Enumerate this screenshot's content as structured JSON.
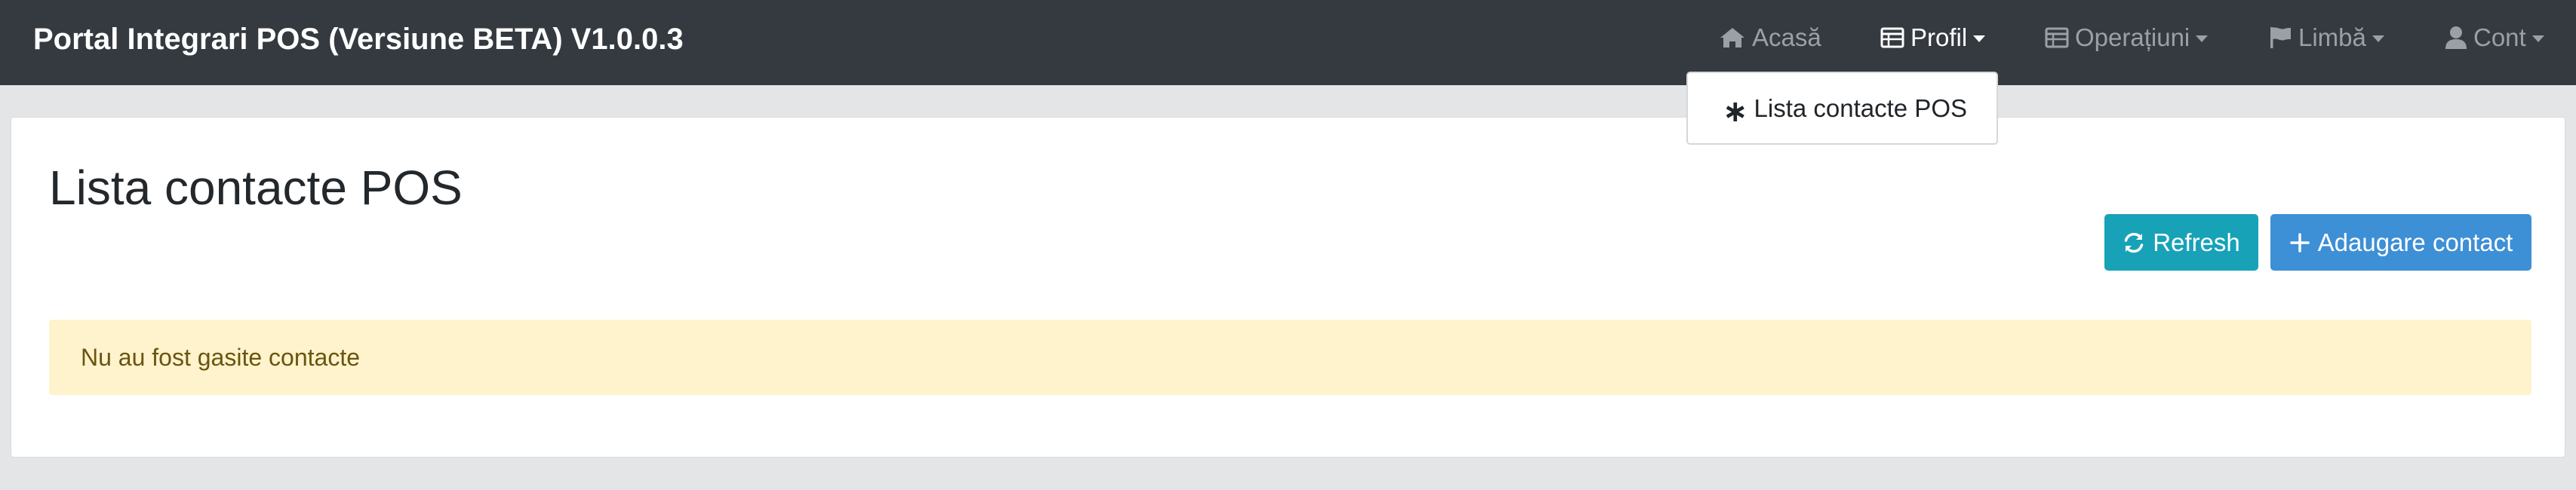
{
  "app": {
    "title": "Portal Integrari POS (Versiune BETA) V1.0.0.3"
  },
  "nav": {
    "home": {
      "label": "Acasă",
      "icon": "home-icon"
    },
    "profile": {
      "label": "Profil",
      "icon": "table-icon",
      "expanded": true
    },
    "operations": {
      "label": "Operațiuni",
      "icon": "table-icon"
    },
    "language": {
      "label": "Limbă",
      "icon": "flag-icon"
    },
    "account": {
      "label": "Cont",
      "icon": "user-icon"
    }
  },
  "profile_menu": {
    "items": [
      {
        "label": "Lista contacte POS",
        "icon": "asterisk-icon"
      }
    ]
  },
  "main": {
    "title": "Lista contacte POS",
    "refresh_label": "Refresh",
    "add_label": "Adaugare contact",
    "empty_message": "Nu au fost gasite contacte"
  },
  "colors": {
    "navbar": "#343a40",
    "refresh_button": "#17a2b8",
    "add_button": "#3d8fd6",
    "alert_background": "#fff3cd",
    "alert_text": "#6b5410"
  }
}
